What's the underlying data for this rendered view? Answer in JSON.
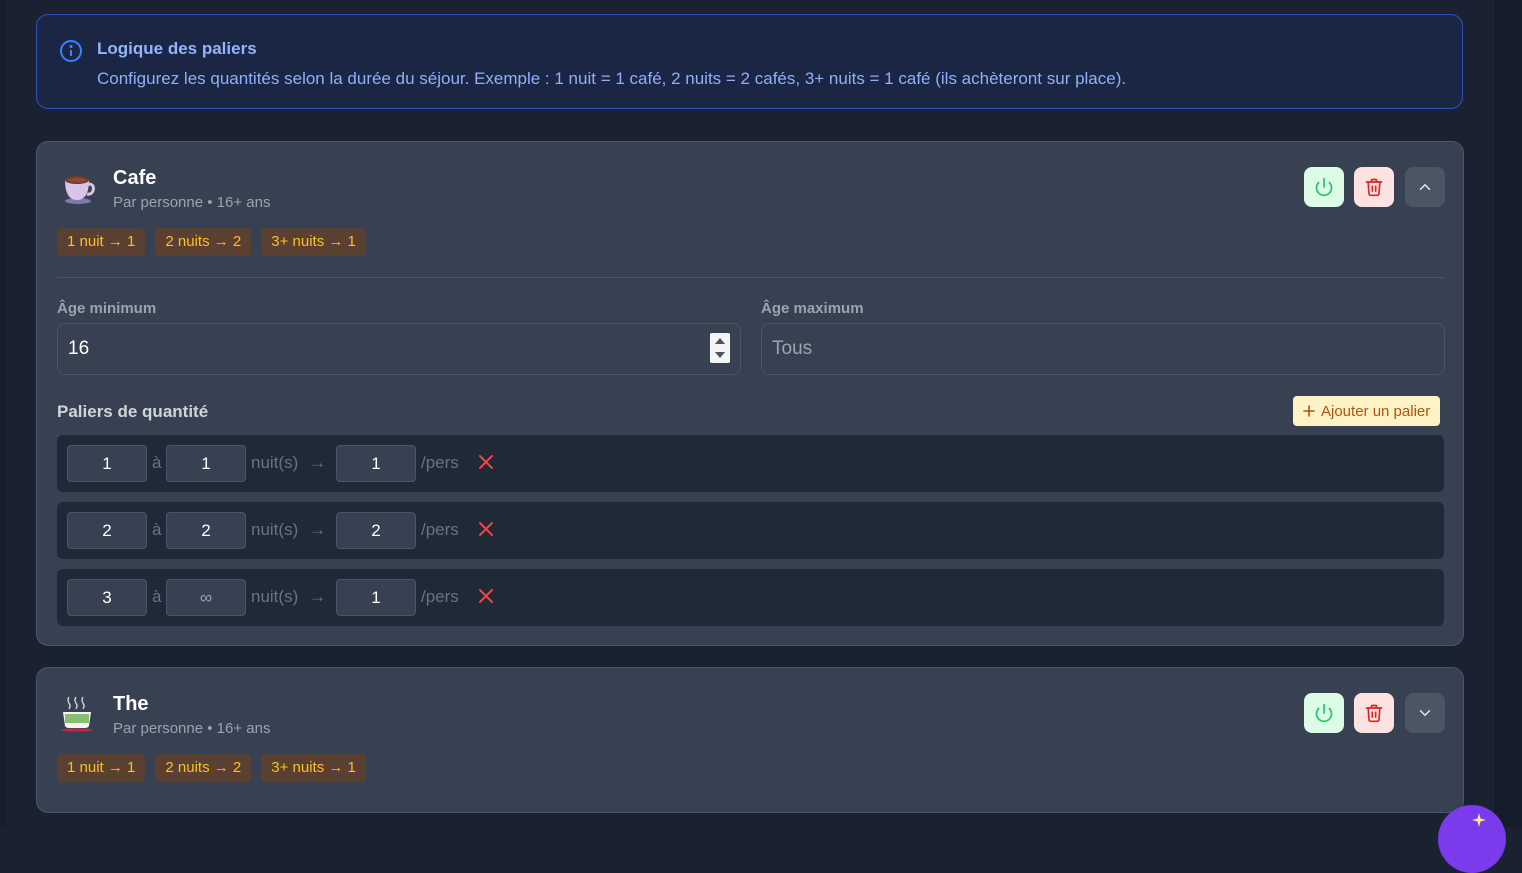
{
  "info": {
    "title": "Logique des paliers",
    "text": "Configurez les quantités selon la durée du séjour. Exemple : 1 nuit = 1 café, 2 nuits = 2 cafés, 3+ nuits = 1 café (ils achèteront sur place)."
  },
  "products": [
    {
      "name": "Cafe",
      "meta": "Par personne • 16+ ans",
      "icon": "coffee-cup-icon",
      "badges": [
        "1 nuit → 1",
        "2 nuits → 2",
        "3+ nuits → 1"
      ],
      "expanded": true,
      "age_min_label": "Âge minimum",
      "age_min_value": "16",
      "age_max_label": "Âge maximum",
      "age_max_placeholder": "Tous",
      "tiers_title": "Paliers de quantité",
      "add_tier_label": "Ajouter un palier",
      "tiers": [
        {
          "from": "1",
          "to": "1",
          "qty": "1"
        },
        {
          "from": "2",
          "to": "2",
          "qty": "2"
        },
        {
          "from": "3",
          "to": "∞",
          "qty": "1"
        }
      ]
    },
    {
      "name": "The",
      "meta": "Par personne • 16+ ans",
      "icon": "hot-tea-icon",
      "badges": [
        "1 nuit → 1",
        "2 nuits → 2",
        "3+ nuits → 1"
      ],
      "expanded": false
    }
  ],
  "tier_labels": {
    "to": "à",
    "nights": "nuit(s)",
    "arrow": "→",
    "per": "/pers"
  },
  "colors": {
    "accent_blue": "#93b4fb",
    "badge_text": "#fbbf24",
    "power_green": "#22c55e",
    "trash_red": "#dc2626",
    "remove_red": "#ef4444",
    "fab_purple": "#7c3aed"
  }
}
